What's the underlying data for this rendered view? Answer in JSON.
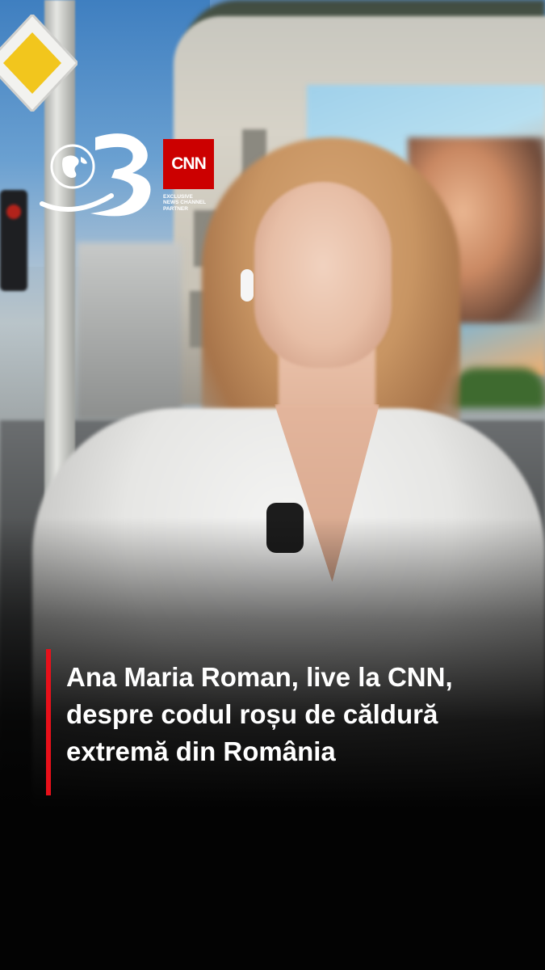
{
  "branding": {
    "channel_logo_icon": "antena-3-globe-logo-icon",
    "partner_logo": "CNN",
    "partner_lines": [
      "EXCLUSIVE",
      "NEWS CHANNEL",
      "PARTNER"
    ],
    "accent_color": "#e8101a",
    "cnn_red": "#cc0000"
  },
  "caption": {
    "lines": [
      "Ana Maria Roman, live la CNN,",
      "despre codul roșu de căldură",
      "extremă din România"
    ]
  }
}
